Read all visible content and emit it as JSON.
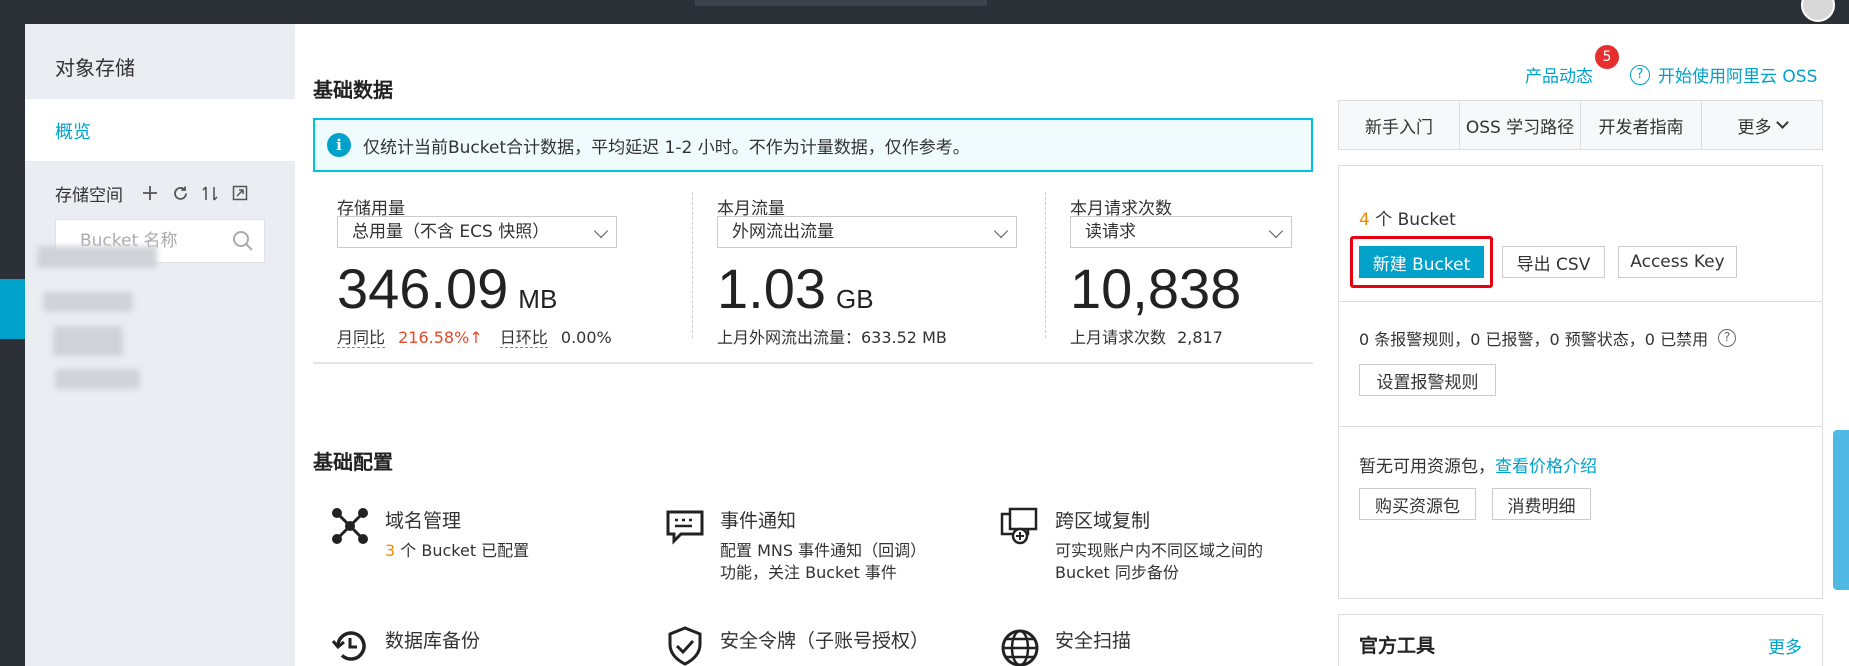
{
  "sidebar": {
    "title": "对象存储",
    "overview": "概览",
    "storage_space": "存储空间",
    "search_placeholder": "Bucket 名称"
  },
  "header": {
    "section_title": "基础数据",
    "news_link": "产品动态",
    "news_badge": "5",
    "start_link": "开始使用阿里云 OSS"
  },
  "notice": "仅统计当前Bucket合计数据，平均延迟 1-2 小时。不作为计量数据，仅作参考。",
  "stats": {
    "storage": {
      "label": "存储用量",
      "select": "总用量（不含 ECS 快照）",
      "value": "346.09",
      "unit": "MB",
      "mom_label": "月同比",
      "mom_value": "216.58%",
      "dod_label": "日环比",
      "dod_value": "0.00%"
    },
    "traffic": {
      "label": "本月流量",
      "select": "外网流出流量",
      "value": "1.03",
      "unit": "GB",
      "sub": "上月外网流出流量：633.52 MB"
    },
    "requests": {
      "label": "本月请求次数",
      "select": "读请求",
      "value": "10,838",
      "sub_label": "上月请求次数",
      "sub_value": "2,817"
    }
  },
  "config": {
    "title": "基础配置",
    "items": [
      {
        "title": "域名管理",
        "count": "3",
        "desc": "个 Bucket 已配置"
      },
      {
        "title": "事件通知",
        "desc1": "配置 MNS 事件通知（回调）",
        "desc2": "功能，关注 Bucket 事件"
      },
      {
        "title": "跨区域复制",
        "desc1": "可实现账户内不同区域之间的",
        "desc2": "Bucket 同步备份"
      },
      {
        "title": "数据库备份"
      },
      {
        "title": "安全令牌（子账号授权）"
      },
      {
        "title": "安全扫描"
      }
    ]
  },
  "right": {
    "tabs": [
      "新手入门",
      "OSS 学习路径",
      "开发者指南",
      "更多"
    ],
    "bucket_count": "4",
    "bucket_text": "个 Bucket",
    "new_bucket": "新建 Bucket",
    "export_csv": "导出 CSV",
    "access_key": "Access Key",
    "alarm_text": "0 条报警规则，0 已报警，0 预警状态，0 已禁用",
    "alarm_button": "设置报警规则",
    "package_text": "暂无可用资源包，",
    "package_link": "查看价格介绍",
    "buy_package": "购买资源包",
    "consume_detail": "消费明细",
    "tools_title": "官方工具",
    "tools_more": "更多"
  },
  "colors": {
    "accent": "#00a2ca",
    "highlight": "#e60012",
    "orange": "#f08c00",
    "badge": "#e62e2e"
  }
}
